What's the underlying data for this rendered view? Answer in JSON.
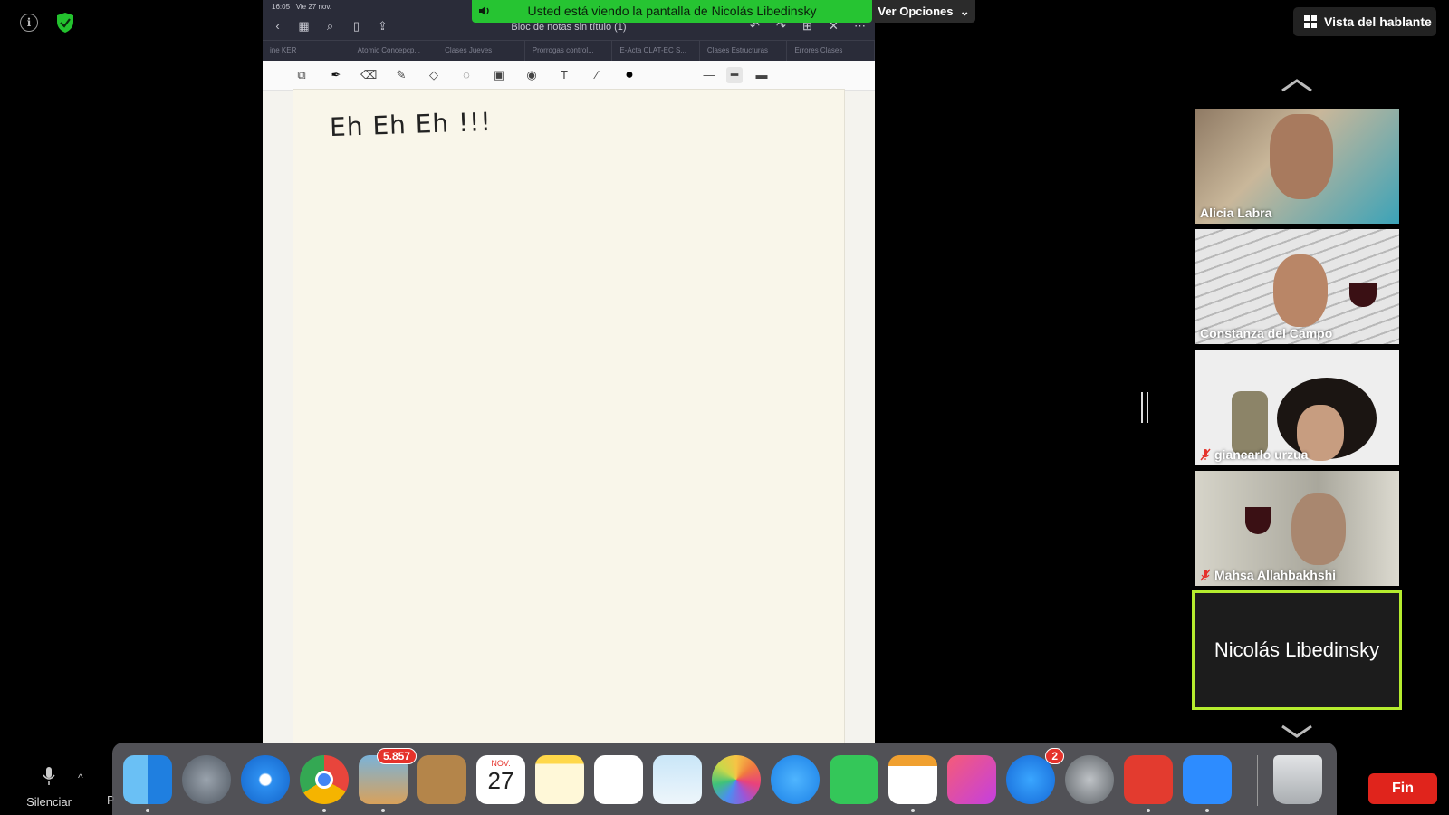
{
  "share_banner": {
    "text": "Usted está viendo la pantalla de Nicolás Libedinsky"
  },
  "view_options": {
    "label": "Ver Opciones"
  },
  "speaker_view": {
    "label": "Vista del hablante"
  },
  "ipad": {
    "status_time": "16:05",
    "status_date": "Vie 27 nov.",
    "doc_title": "Bloc de notas sin título (1)",
    "tabs": [
      "ine KER",
      "Atomic Concepcp...",
      "Clases Jueves",
      "Prorrogas control...",
      "E-Acta CLAT-EC S...",
      "Clases Estructuras",
      "Errores Clases"
    ],
    "handwriting": "Eh Eh Eh !!!"
  },
  "participants": [
    {
      "name": "Alicia Labra",
      "muted": false,
      "bg": "#8f7a64"
    },
    {
      "name": "Constanza del Campo",
      "muted": false,
      "bg": "#cfcfcf"
    },
    {
      "name": "giancarlo urzua",
      "muted": true,
      "bg": "#c8c8c8"
    },
    {
      "name": "Mahsa Allahbakhshi",
      "muted": true,
      "bg": "#b7b7ad"
    }
  ],
  "self_tile": {
    "name": "Nicolás Libedinsky",
    "border": "#b5ec2e"
  },
  "bottom": {
    "mute_label": "Silenciar",
    "cut_label": "P",
    "end_label": "Fin"
  },
  "dock": {
    "mail_badge": "5.857",
    "appstore_badge": "2",
    "calendar_month": "NOV.",
    "calendar_day": "27"
  }
}
